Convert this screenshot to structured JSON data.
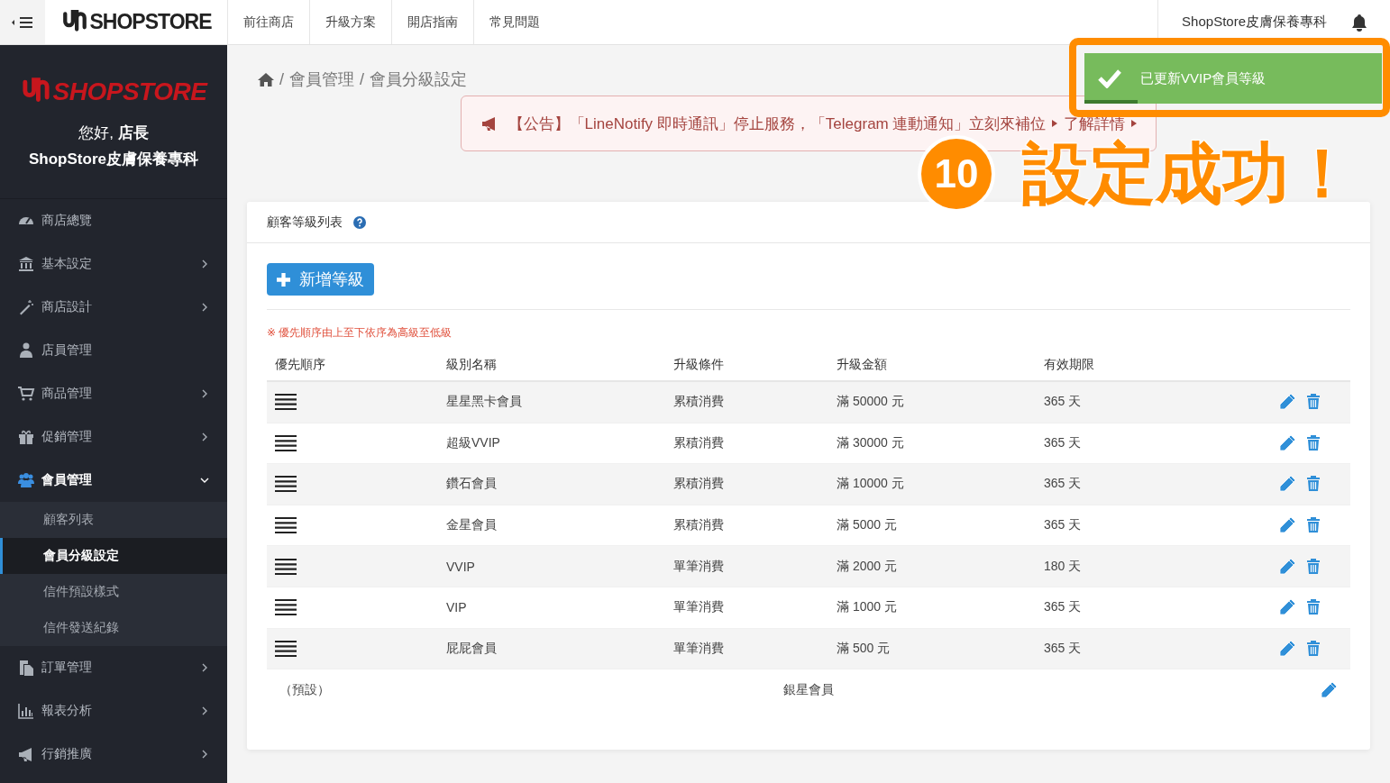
{
  "topbar": {
    "logo": "SHOPSTORE",
    "nav": [
      "前往商店",
      "升級方案",
      "開店指南",
      "常見問題"
    ],
    "shop_name": "ShopStore皮膚保養專科"
  },
  "sidebar": {
    "logo": "SHOPSTORE",
    "greeting": "您好, **店長**",
    "store_name": "ShopStore皮膚保養專科",
    "menu": [
      {
        "label": "商店總覽",
        "kind": "link"
      },
      {
        "label": "基本設定",
        "kind": "group",
        "expanded": false
      },
      {
        "label": "商店設計",
        "kind": "group",
        "expanded": false
      },
      {
        "label": "店員管理",
        "kind": "link"
      },
      {
        "label": "商品管理",
        "kind": "group",
        "expanded": false
      },
      {
        "label": "促銷管理",
        "kind": "group",
        "expanded": false
      },
      {
        "label": "會員管理",
        "kind": "group",
        "expanded": true,
        "children": [
          {
            "label": "顧客列表",
            "selected": false
          },
          {
            "label": "會員分級設定",
            "selected": true
          },
          {
            "label": "信件預設樣式",
            "selected": false
          },
          {
            "label": "信件發送紀錄",
            "selected": false
          }
        ]
      },
      {
        "label": "訂單管理",
        "kind": "group",
        "expanded": false
      },
      {
        "label": "報表分析",
        "kind": "group",
        "expanded": false
      },
      {
        "label": "行銷推廣",
        "kind": "group",
        "expanded": false
      }
    ]
  },
  "breadcrumb": [
    {
      "separator": "/",
      "label": "會員管理"
    },
    {
      "separator": "/",
      "label": "會員分級設定"
    }
  ],
  "announcement": {
    "text": "【公告】「LineNotify 即時通訊」停止服務，「Telegram 連動通知」立刻來補位",
    "link": "了解詳情"
  },
  "card": {
    "title": "顧客等級列表",
    "add_button": "新增等級",
    "note": "※ 優先順序由上至下依序為高級至低級",
    "table": {
      "columns": [
        "優先順序",
        "級別名稱",
        "升級條件",
        "升級金額",
        "有效期限"
      ],
      "rows": [
        {
          "name": "星星黑卡會員",
          "condition": "累積消費",
          "amount": "滿 50000 元",
          "validity": "365 天"
        },
        {
          "name": "超級VVIP",
          "condition": "累積消費",
          "amount": "滿 30000 元",
          "validity": "365 天"
        },
        {
          "name": "鑽石會員",
          "condition": "累積消費",
          "amount": "滿 10000 元",
          "validity": "365 天"
        },
        {
          "name": "金星會員",
          "condition": "累積消費",
          "amount": "滿 5000 元",
          "validity": "365 天"
        },
        {
          "name": "VVIP",
          "condition": "單筆消費",
          "amount": "滿 2000 元",
          "validity": "180 天"
        },
        {
          "name": "VIP",
          "condition": "單筆消費",
          "amount": "滿 1000 元",
          "validity": "365 天"
        },
        {
          "name": "屁屁會員",
          "condition": "單筆消費",
          "amount": "滿 500 元",
          "validity": "365 天"
        }
      ],
      "default_row": {
        "label": "（預設）",
        "name": "銀星會員"
      }
    }
  },
  "toast": {
    "message": "已更新VVIP會員等級",
    "level": 0.18
  },
  "annotation": {
    "step": "10",
    "text": "設定成功！"
  }
}
